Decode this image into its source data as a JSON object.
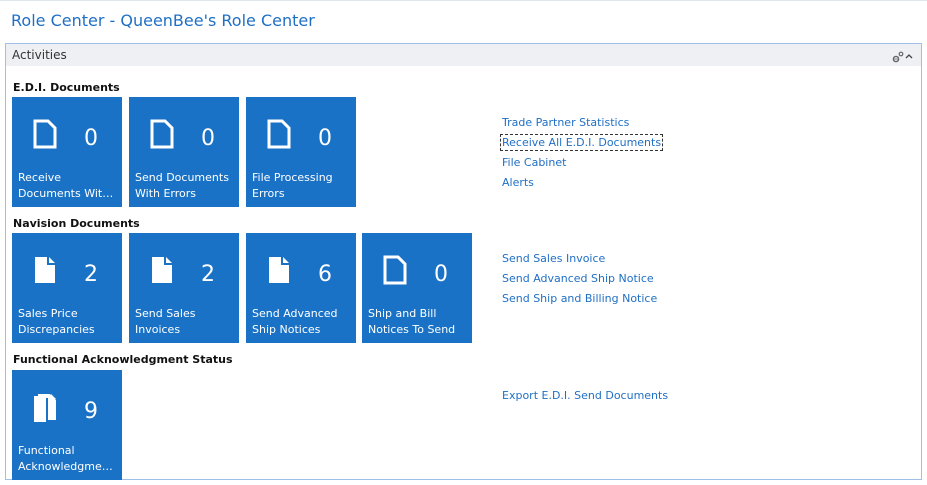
{
  "page": {
    "title": "Role Center - QueenBee's Role Center"
  },
  "panel": {
    "title": "Activities",
    "tools": [
      "customize-icon",
      "collapse-icon"
    ]
  },
  "sections": [
    {
      "title": "E.D.I. Documents",
      "tiles": [
        {
          "count": "0",
          "label_lines": [
            "Receive",
            "Documents With..."
          ],
          "icon": "document-outline-icon"
        },
        {
          "count": "0",
          "label_lines": [
            "Send Documents",
            "With Errors"
          ],
          "icon": "document-outline-icon"
        },
        {
          "count": "0",
          "label_lines": [
            "File Processing",
            "Errors"
          ],
          "icon": "document-outline-icon"
        }
      ],
      "links": [
        "Trade Partner Statistics",
        "Receive All E.D.I. Documents",
        "File Cabinet",
        "Alerts"
      ],
      "focused_link_index": 1
    },
    {
      "title": "Navision Documents",
      "tiles": [
        {
          "count": "2",
          "label_lines": [
            "Sales Price",
            "Discrepancies"
          ],
          "icon": "document-filled-icon"
        },
        {
          "count": "2",
          "label_lines": [
            "Send Sales",
            "Invoices"
          ],
          "icon": "document-filled-icon"
        },
        {
          "count": "6",
          "label_lines": [
            "Send Advanced",
            "Ship Notices"
          ],
          "icon": "document-filled-icon"
        },
        {
          "count": "0",
          "label_lines": [
            "Ship and Bill",
            "Notices To Send"
          ],
          "icon": "document-outline-icon"
        }
      ],
      "links": [
        "Send Sales Invoice",
        "Send Advanced Ship Notice",
        "Send Ship and Billing Notice"
      ]
    },
    {
      "title": "Functional Acknowledgment Status",
      "tiles": [
        {
          "count": "9",
          "label_lines": [
            "Functional",
            "Acknowledgmen..."
          ],
          "icon": "document-stack-icon"
        }
      ],
      "links": [
        "Export E.D.I. Send Documents"
      ]
    }
  ],
  "colors": {
    "tile": "#1a72c7",
    "link": "#1f6fc5",
    "title": "#1f6fc5"
  }
}
